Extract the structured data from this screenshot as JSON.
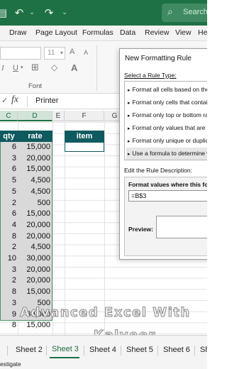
{
  "titlebar": {
    "search_label": "Search",
    "undo_icon": "undo-icon",
    "redo_icon": "redo-icon"
  },
  "ribbon_tabs": [
    "Draw",
    "Page Layout",
    "Formulas",
    "Data",
    "Review",
    "View",
    "He"
  ],
  "ribbon": {
    "font_size": "11",
    "grow_font": "A",
    "shrink_font": "A",
    "italic": "I",
    "underline": "U",
    "group_label": "Font"
  },
  "formula_bar": {
    "fx": "fx",
    "value": "Printer"
  },
  "columns": [
    "C",
    "D",
    "E",
    "F",
    "G"
  ],
  "table": {
    "headers": {
      "qty": "qty",
      "rate": "rate"
    },
    "rows": [
      {
        "qty": "6",
        "rate": "15,000"
      },
      {
        "qty": "3",
        "rate": "20,000"
      },
      {
        "qty": "6",
        "rate": "15,000"
      },
      {
        "qty": "5",
        "rate": "4,500"
      },
      {
        "qty": "5",
        "rate": "4,500"
      },
      {
        "qty": "2",
        "rate": "500"
      },
      {
        "qty": "6",
        "rate": "15,000"
      },
      {
        "qty": "4",
        "rate": "20,000"
      },
      {
        "qty": "8",
        "rate": "20,000"
      },
      {
        "qty": "2",
        "rate": "4,500"
      },
      {
        "qty": "10",
        "rate": "30,000"
      },
      {
        "qty": "3",
        "rate": "20,000"
      },
      {
        "qty": "2",
        "rate": "20,000"
      },
      {
        "qty": "8",
        "rate": "15,000"
      },
      {
        "qty": "3",
        "rate": "500"
      },
      {
        "qty": "9",
        "rate": "30,000"
      },
      {
        "qty": "8",
        "rate": "15,000"
      }
    ]
  },
  "item_header": "item",
  "watermark": {
    "line1": "Advanced Excel With",
    "line2": "Kalveer"
  },
  "dialog": {
    "title": "New Formatting Rule",
    "select_type_label": "Select a Rule Type:",
    "rule_types": [
      "Format all cells based on their values",
      "Format only cells that contain",
      "Format only top or bottom ranked values",
      "Format only values that are above or below average",
      "Format only unique or duplicate values",
      "Use a formula to determine which cells to format"
    ],
    "edit_desc_label": "Edit the Rule Description:",
    "format_values_label": "Format values where this formula is true:",
    "formula_value": "=B$3",
    "preview_label": "Preview:"
  },
  "sheets": [
    "Sheet 2",
    "Sheet 3",
    "Sheet 4",
    "Sheet 5",
    "Sheet 6",
    "Sh"
  ],
  "status": "estigate"
}
